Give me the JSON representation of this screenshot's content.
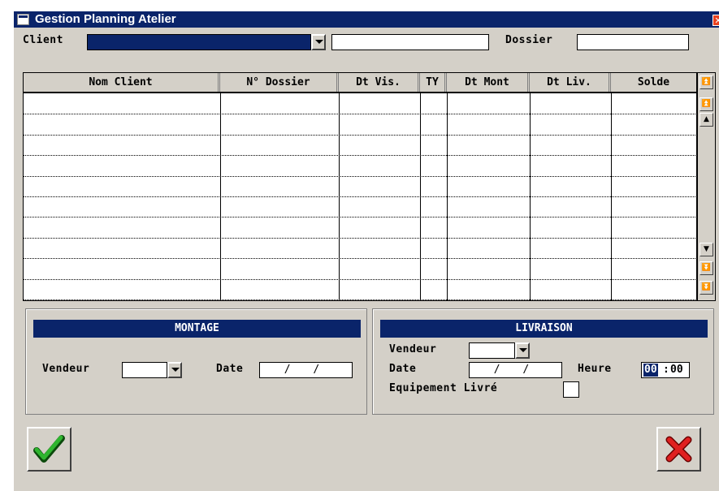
{
  "window": {
    "title": "Gestion Planning Atelier",
    "close_glyph": "✕"
  },
  "filters": {
    "client_label": "Client",
    "client_combo_value": "",
    "client_text_value": "",
    "dossier_label": "Dossier",
    "dossier_value": ""
  },
  "grid": {
    "columns": [
      "Nom Client",
      "N° Dossier",
      "Dt Vis.",
      "TY",
      "Dt Mont",
      "Dt Liv.",
      "Solde"
    ],
    "rows": [
      [
        "",
        "",
        "",
        "",
        "",
        "",
        ""
      ],
      [
        "",
        "",
        "",
        "",
        "",
        "",
        ""
      ],
      [
        "",
        "",
        "",
        "",
        "",
        "",
        ""
      ],
      [
        "",
        "",
        "",
        "",
        "",
        "",
        ""
      ],
      [
        "",
        "",
        "",
        "",
        "",
        "",
        ""
      ],
      [
        "",
        "",
        "",
        "",
        "",
        "",
        ""
      ],
      [
        "",
        "",
        "",
        "",
        "",
        "",
        ""
      ],
      [
        "",
        "",
        "",
        "",
        "",
        "",
        ""
      ],
      [
        "",
        "",
        "",
        "",
        "",
        "",
        ""
      ],
      [
        "",
        "",
        "",
        "",
        "",
        "",
        ""
      ]
    ]
  },
  "montage": {
    "title": "MONTAGE",
    "vendeur_label": "Vendeur",
    "vendeur_value": "",
    "date_label": "Date",
    "date_value": "/ /"
  },
  "livraison": {
    "title": "LIVRAISON",
    "vendeur_label": "Vendeur",
    "vendeur_value": "",
    "date_label": "Date",
    "date_value": "/ /",
    "heure_label": "Heure",
    "heure_hh": "00",
    "heure_mm": "00",
    "equipement_label": "Equipement Livré",
    "equipement_checked": false
  },
  "buttons": {
    "ok_icon": "checkmark-icon",
    "cancel_icon": "cross-icon"
  },
  "colors": {
    "title_bar": "#0a246a",
    "ok_green": "#2fb52f",
    "cancel_red": "#e02020"
  }
}
